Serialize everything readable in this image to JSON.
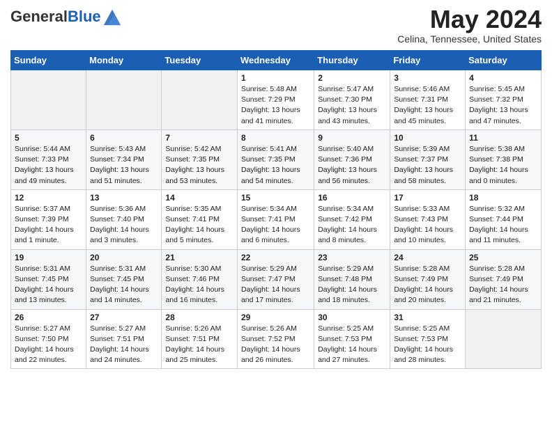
{
  "header": {
    "logo_general": "General",
    "logo_blue": "Blue",
    "month": "May 2024",
    "location": "Celina, Tennessee, United States"
  },
  "days_of_week": [
    "Sunday",
    "Monday",
    "Tuesday",
    "Wednesday",
    "Thursday",
    "Friday",
    "Saturday"
  ],
  "weeks": [
    [
      {
        "day": "",
        "info": ""
      },
      {
        "day": "",
        "info": ""
      },
      {
        "day": "",
        "info": ""
      },
      {
        "day": "1",
        "info": "Sunrise: 5:48 AM\nSunset: 7:29 PM\nDaylight: 13 hours\nand 41 minutes."
      },
      {
        "day": "2",
        "info": "Sunrise: 5:47 AM\nSunset: 7:30 PM\nDaylight: 13 hours\nand 43 minutes."
      },
      {
        "day": "3",
        "info": "Sunrise: 5:46 AM\nSunset: 7:31 PM\nDaylight: 13 hours\nand 45 minutes."
      },
      {
        "day": "4",
        "info": "Sunrise: 5:45 AM\nSunset: 7:32 PM\nDaylight: 13 hours\nand 47 minutes."
      }
    ],
    [
      {
        "day": "5",
        "info": "Sunrise: 5:44 AM\nSunset: 7:33 PM\nDaylight: 13 hours\nand 49 minutes."
      },
      {
        "day": "6",
        "info": "Sunrise: 5:43 AM\nSunset: 7:34 PM\nDaylight: 13 hours\nand 51 minutes."
      },
      {
        "day": "7",
        "info": "Sunrise: 5:42 AM\nSunset: 7:35 PM\nDaylight: 13 hours\nand 53 minutes."
      },
      {
        "day": "8",
        "info": "Sunrise: 5:41 AM\nSunset: 7:35 PM\nDaylight: 13 hours\nand 54 minutes."
      },
      {
        "day": "9",
        "info": "Sunrise: 5:40 AM\nSunset: 7:36 PM\nDaylight: 13 hours\nand 56 minutes."
      },
      {
        "day": "10",
        "info": "Sunrise: 5:39 AM\nSunset: 7:37 PM\nDaylight: 13 hours\nand 58 minutes."
      },
      {
        "day": "11",
        "info": "Sunrise: 5:38 AM\nSunset: 7:38 PM\nDaylight: 14 hours\nand 0 minutes."
      }
    ],
    [
      {
        "day": "12",
        "info": "Sunrise: 5:37 AM\nSunset: 7:39 PM\nDaylight: 14 hours\nand 1 minute."
      },
      {
        "day": "13",
        "info": "Sunrise: 5:36 AM\nSunset: 7:40 PM\nDaylight: 14 hours\nand 3 minutes."
      },
      {
        "day": "14",
        "info": "Sunrise: 5:35 AM\nSunset: 7:41 PM\nDaylight: 14 hours\nand 5 minutes."
      },
      {
        "day": "15",
        "info": "Sunrise: 5:34 AM\nSunset: 7:41 PM\nDaylight: 14 hours\nand 6 minutes."
      },
      {
        "day": "16",
        "info": "Sunrise: 5:34 AM\nSunset: 7:42 PM\nDaylight: 14 hours\nand 8 minutes."
      },
      {
        "day": "17",
        "info": "Sunrise: 5:33 AM\nSunset: 7:43 PM\nDaylight: 14 hours\nand 10 minutes."
      },
      {
        "day": "18",
        "info": "Sunrise: 5:32 AM\nSunset: 7:44 PM\nDaylight: 14 hours\nand 11 minutes."
      }
    ],
    [
      {
        "day": "19",
        "info": "Sunrise: 5:31 AM\nSunset: 7:45 PM\nDaylight: 14 hours\nand 13 minutes."
      },
      {
        "day": "20",
        "info": "Sunrise: 5:31 AM\nSunset: 7:45 PM\nDaylight: 14 hours\nand 14 minutes."
      },
      {
        "day": "21",
        "info": "Sunrise: 5:30 AM\nSunset: 7:46 PM\nDaylight: 14 hours\nand 16 minutes."
      },
      {
        "day": "22",
        "info": "Sunrise: 5:29 AM\nSunset: 7:47 PM\nDaylight: 14 hours\nand 17 minutes."
      },
      {
        "day": "23",
        "info": "Sunrise: 5:29 AM\nSunset: 7:48 PM\nDaylight: 14 hours\nand 18 minutes."
      },
      {
        "day": "24",
        "info": "Sunrise: 5:28 AM\nSunset: 7:49 PM\nDaylight: 14 hours\nand 20 minutes."
      },
      {
        "day": "25",
        "info": "Sunrise: 5:28 AM\nSunset: 7:49 PM\nDaylight: 14 hours\nand 21 minutes."
      }
    ],
    [
      {
        "day": "26",
        "info": "Sunrise: 5:27 AM\nSunset: 7:50 PM\nDaylight: 14 hours\nand 22 minutes."
      },
      {
        "day": "27",
        "info": "Sunrise: 5:27 AM\nSunset: 7:51 PM\nDaylight: 14 hours\nand 24 minutes."
      },
      {
        "day": "28",
        "info": "Sunrise: 5:26 AM\nSunset: 7:51 PM\nDaylight: 14 hours\nand 25 minutes."
      },
      {
        "day": "29",
        "info": "Sunrise: 5:26 AM\nSunset: 7:52 PM\nDaylight: 14 hours\nand 26 minutes."
      },
      {
        "day": "30",
        "info": "Sunrise: 5:25 AM\nSunset: 7:53 PM\nDaylight: 14 hours\nand 27 minutes."
      },
      {
        "day": "31",
        "info": "Sunrise: 5:25 AM\nSunset: 7:53 PM\nDaylight: 14 hours\nand 28 minutes."
      },
      {
        "day": "",
        "info": ""
      }
    ]
  ]
}
